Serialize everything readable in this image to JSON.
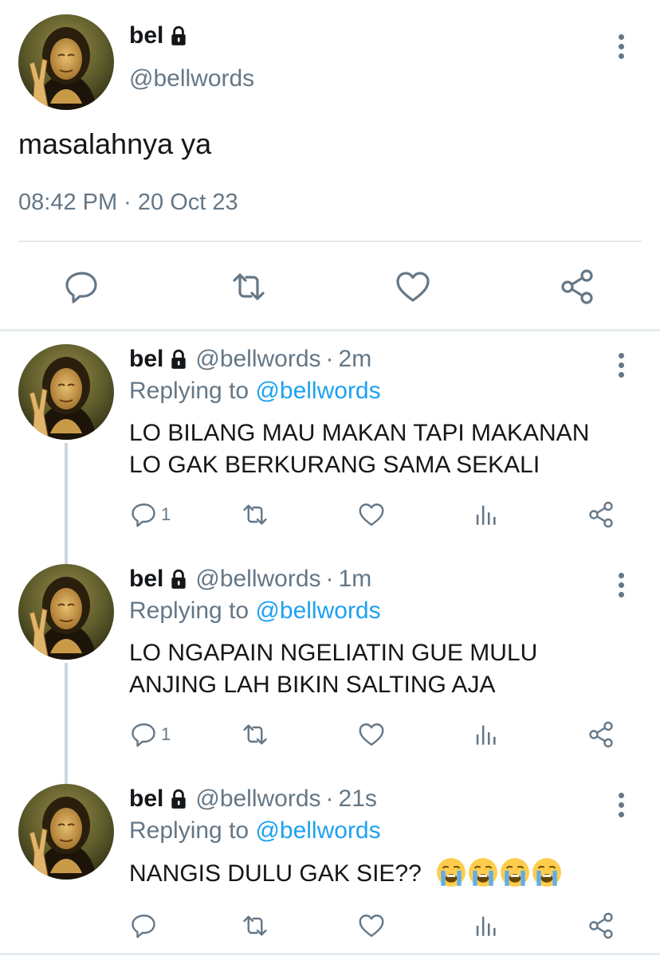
{
  "main_tweet": {
    "name": "bel",
    "handle": "@bellwords",
    "text": "masalahnya ya",
    "meta": "08:42 PM · 20 Oct 23"
  },
  "replies": [
    {
      "name": "bel",
      "handle": "@bellwords",
      "separator": "·",
      "time": "2m",
      "replying_prefix": "Replying to",
      "replying_to": "@bellwords",
      "lines": [
        "LO BILANG MAU MAKAN TAPI MAKANAN",
        "LO GAK BERKURANG SAMA SEKALI"
      ],
      "reply_count": "1"
    },
    {
      "name": "bel",
      "handle": "@bellwords",
      "separator": "·",
      "time": "1m",
      "replying_prefix": "Replying to",
      "replying_to": "@bellwords",
      "lines": [
        "LO NGAPAIN NGELIATIN GUE MULU",
        "ANJING LAH BIKIN SALTING AJA"
      ],
      "reply_count": "1"
    },
    {
      "name": "bel",
      "handle": "@bellwords",
      "separator": "·",
      "time": "21s",
      "replying_prefix": "Replying to",
      "replying_to": "@bellwords",
      "lines": [
        "NANGIS DULU GAK SIE??"
      ],
      "emoji": [
        "loudly-crying-face",
        "loudly-crying-face",
        "loudly-crying-face",
        "loudly-crying-face"
      ],
      "reply_count": ""
    }
  ],
  "icons": {
    "lock": "lock-icon",
    "reply": "reply-icon",
    "retweet": "retweet-icon",
    "like": "heart-icon",
    "analytics": "analytics-icon",
    "share": "share-icon",
    "more": "more-vertical-icon"
  },
  "colors": {
    "text": "#14171a",
    "secondary": "#657786",
    "link": "#1da1f2",
    "divider": "#e1e8ed",
    "thread_line": "#ccd6dd"
  }
}
